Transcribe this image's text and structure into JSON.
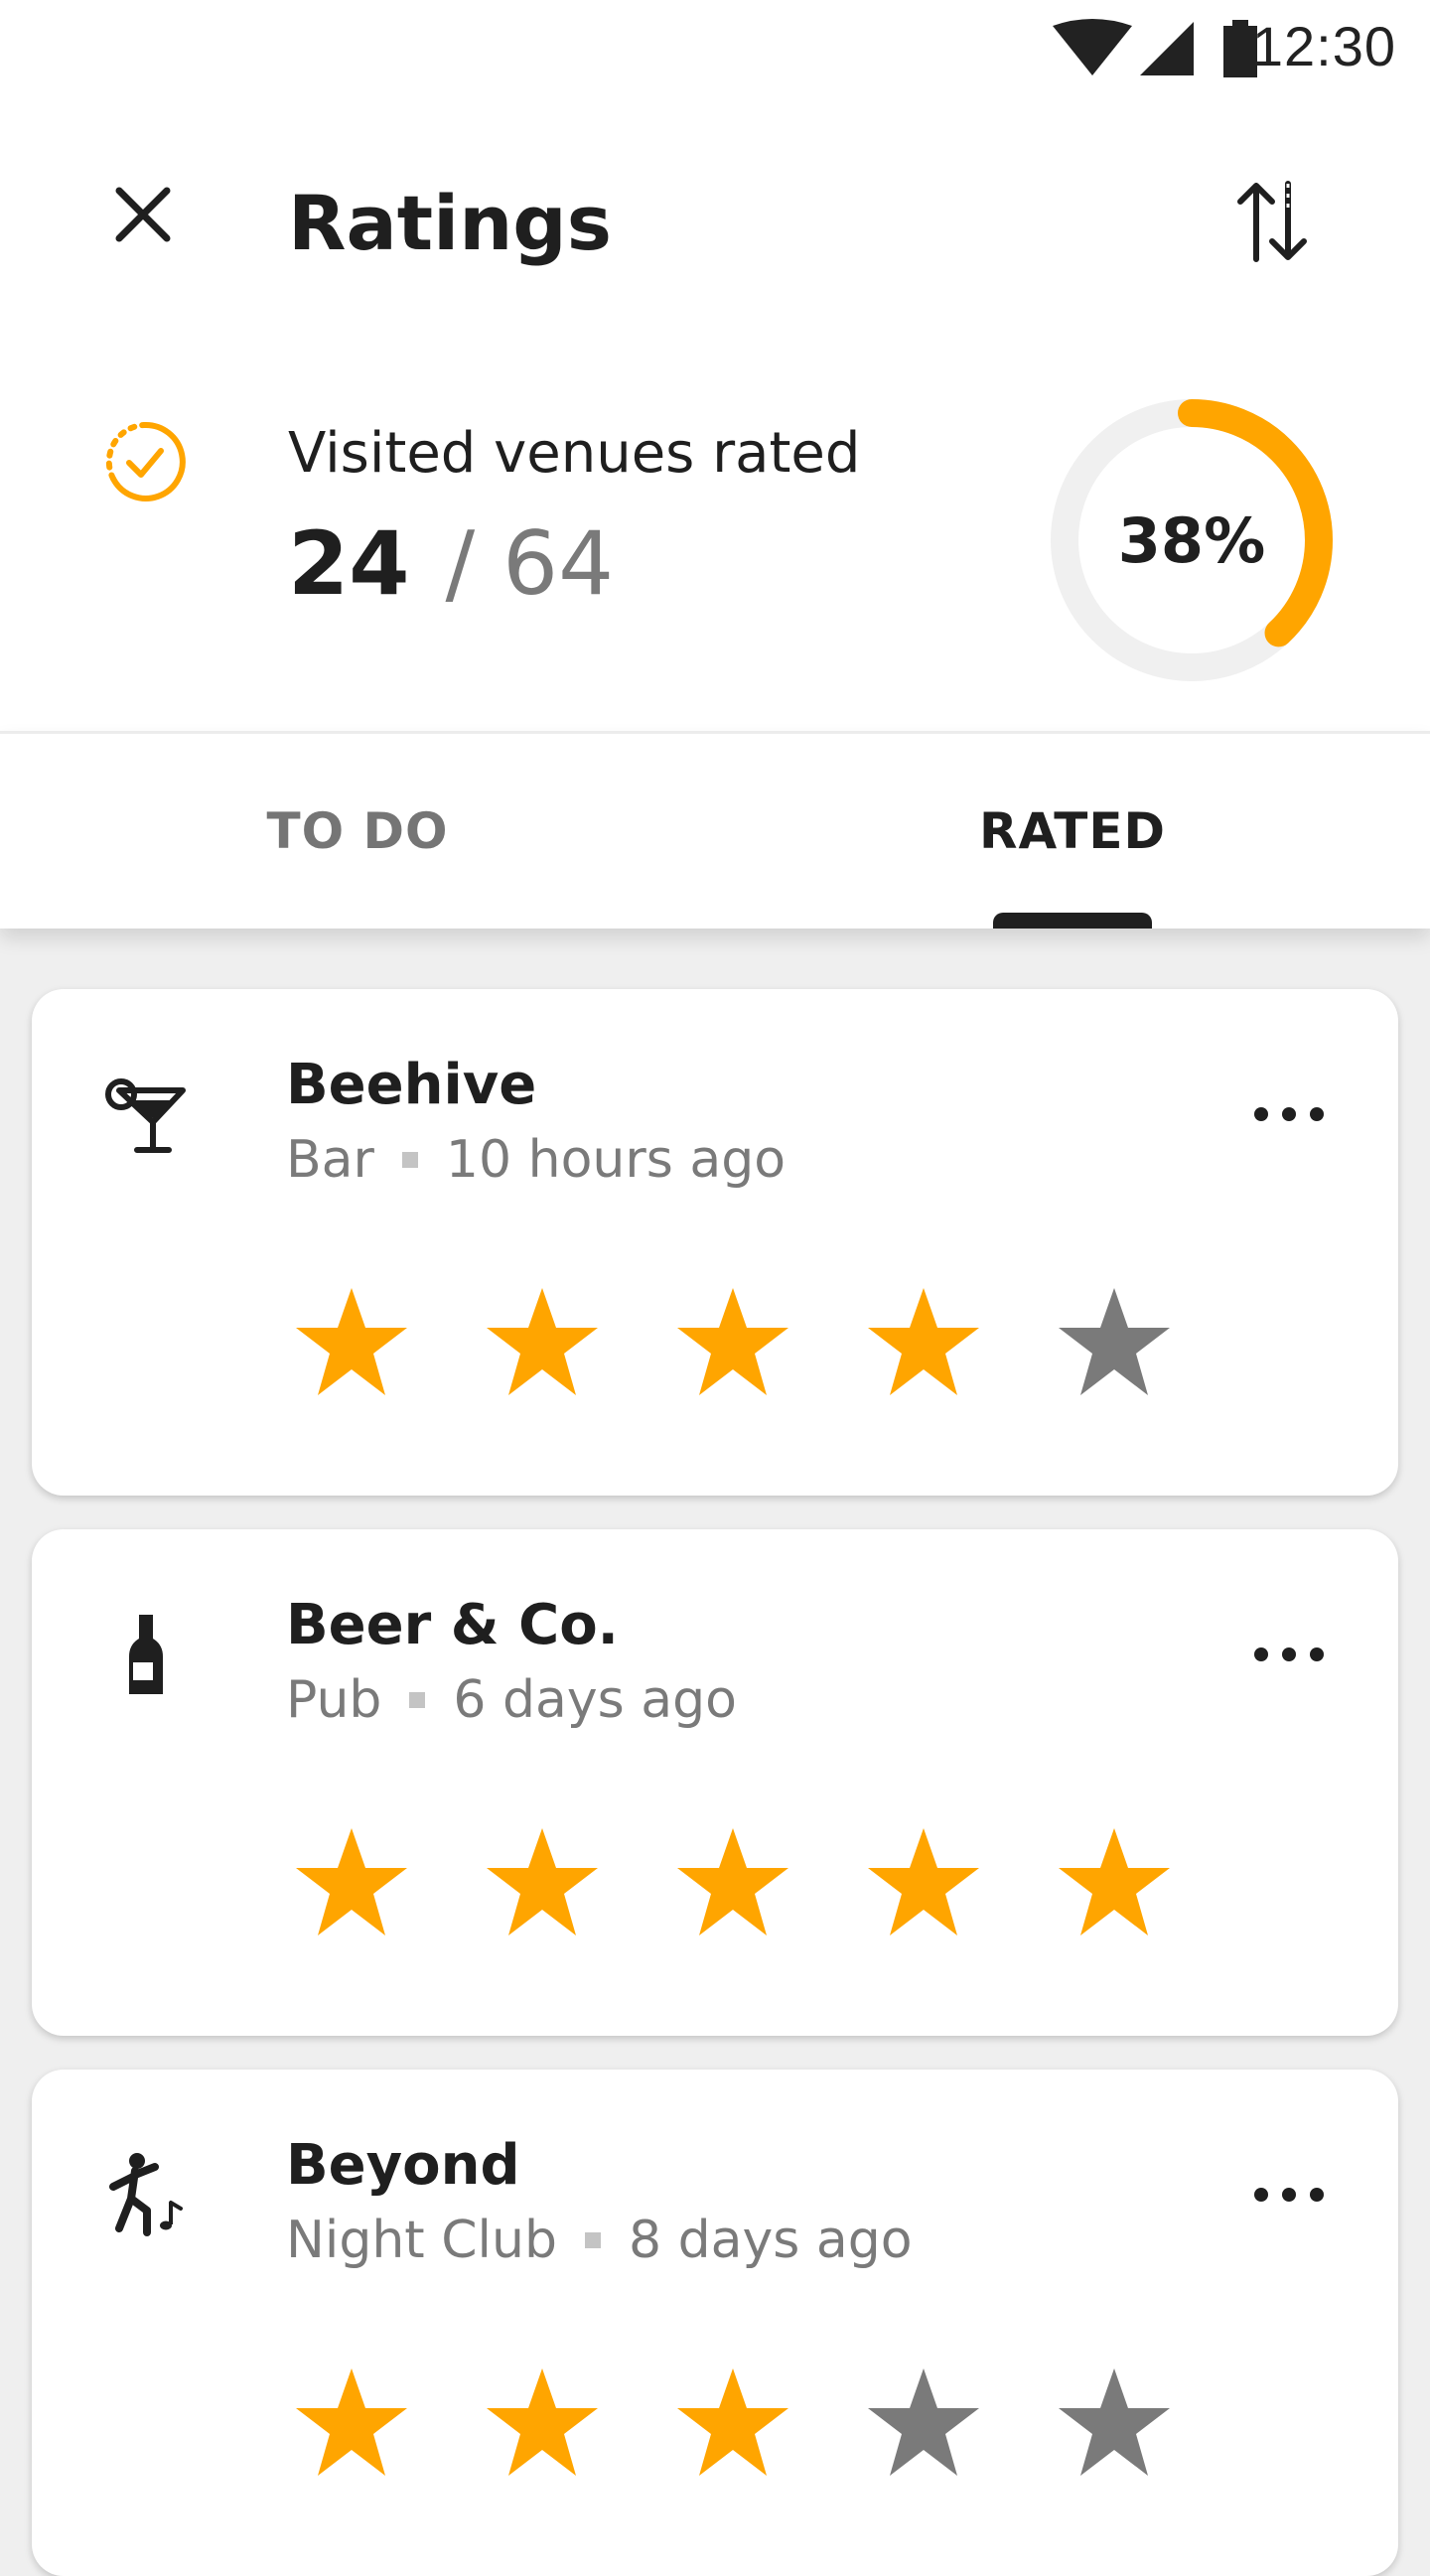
{
  "status": {
    "time": "12:30"
  },
  "header": {
    "title": "Ratings",
    "visited_label": "Visited venues rated",
    "rated_count": "24",
    "separator": "/",
    "total_count": "64",
    "percent_text": "38%",
    "progress_fraction": 0.38
  },
  "tabs": [
    {
      "label": "TO DO",
      "selected": false
    },
    {
      "label": "RATED",
      "selected": true
    }
  ],
  "venues": [
    {
      "name": "Beehive",
      "category": "Bar",
      "time": "10 hours ago",
      "icon": "cocktail-icon",
      "rating": 4,
      "max_rating": 5
    },
    {
      "name": "Beer & Co.",
      "category": "Pub",
      "time": "6 days ago",
      "icon": "bottle-icon",
      "rating": 5,
      "max_rating": 5
    },
    {
      "name": "Beyond",
      "category": "Night Club",
      "time": "8 days ago",
      "icon": "dancer-icon",
      "rating": 3,
      "max_rating": 5
    }
  ],
  "colors": {
    "accent": "#FFA500",
    "star_off": "#7a7a7a",
    "ring_track": "#f0f0f0",
    "text": "#1f1f1f",
    "muted": "#7a7a7a"
  }
}
